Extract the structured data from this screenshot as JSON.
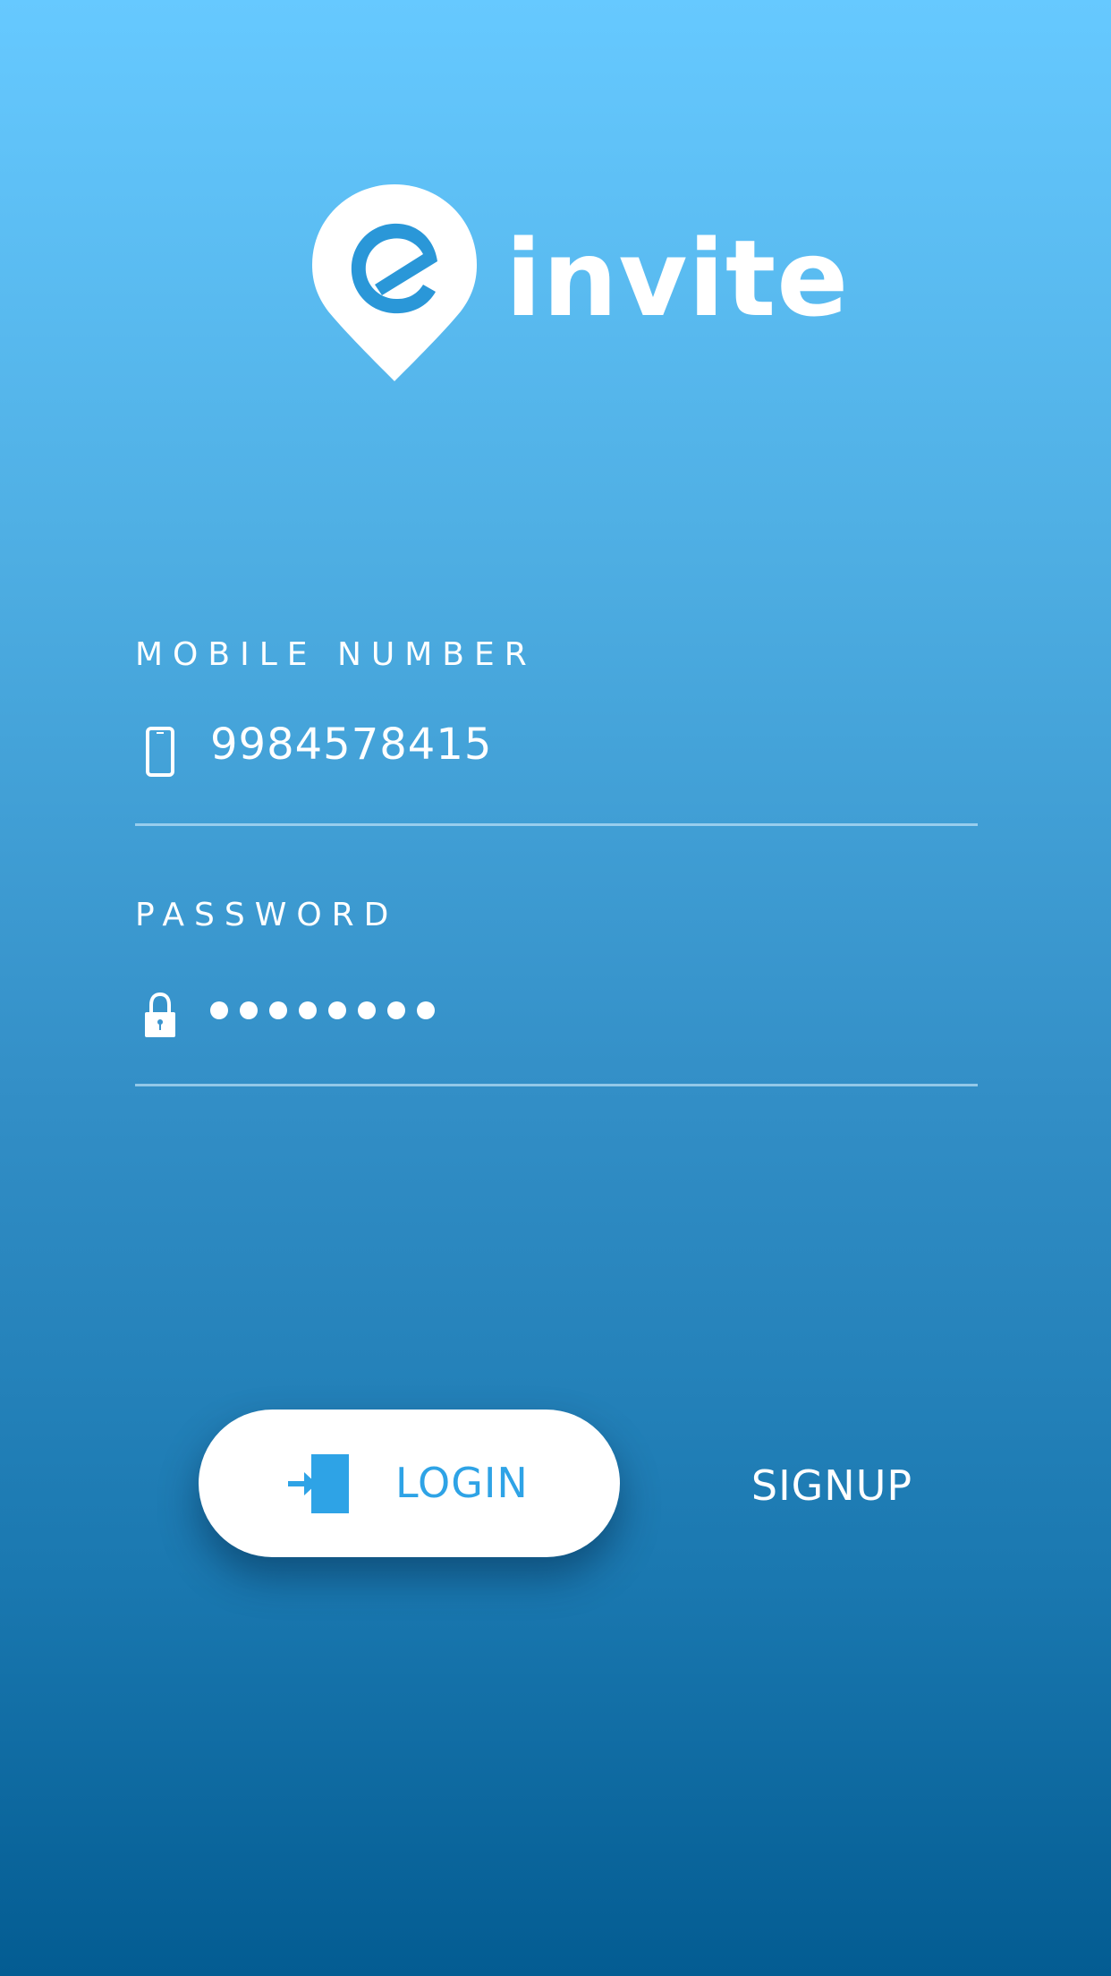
{
  "app": {
    "logo_text": "invite",
    "logo_letter": "e"
  },
  "form": {
    "mobile": {
      "label": "MOBILE NUMBER",
      "value": "9984578415",
      "icon": "mobile-phone-icon"
    },
    "password": {
      "label": "PASSWORD",
      "masked_length": 8,
      "icon": "lock-icon"
    }
  },
  "actions": {
    "login_label": "LOGIN",
    "login_icon": "login-door-icon",
    "signup_label": "SIGNUP"
  },
  "colors": {
    "gradient_top": "#66c9ff",
    "gradient_bottom": "#035c92",
    "accent": "#2ea3e6",
    "button_bg": "#ffffff"
  }
}
